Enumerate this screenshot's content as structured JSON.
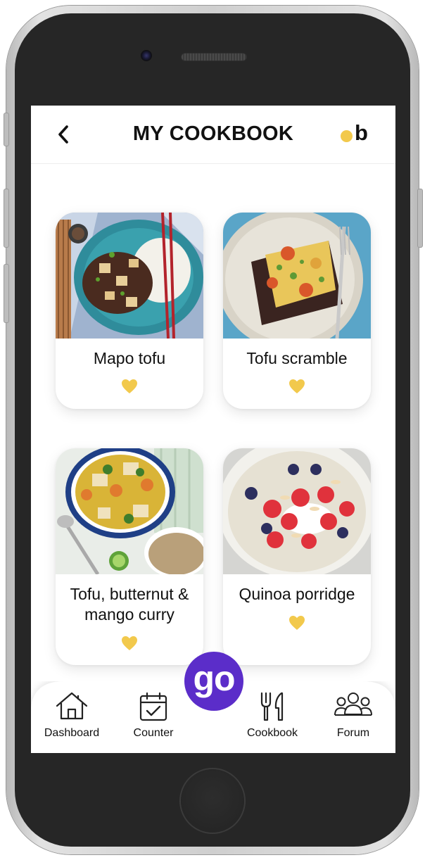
{
  "header": {
    "title": "MY COOKBOOK",
    "back_icon": "chevron-left-icon",
    "brand_letter": "b",
    "brand_dot_color": "#f2c94c"
  },
  "recipes": [
    {
      "title": "Mapo tofu",
      "favorite": true,
      "image": "mapo-tofu-photo"
    },
    {
      "title": "Tofu scramble",
      "favorite": true,
      "image": "tofu-scramble-photo"
    },
    {
      "title": "Tofu, butternut & mango curry",
      "favorite": true,
      "image": "curry-photo"
    },
    {
      "title": "Quinoa porridge",
      "favorite": true,
      "image": "porridge-photo"
    }
  ],
  "tabbar": {
    "items": [
      {
        "label": "Dashboard",
        "icon": "home-icon"
      },
      {
        "label": "Counter",
        "icon": "calendar-check-icon"
      },
      {
        "label": "Cookbook",
        "icon": "fork-knife-icon"
      },
      {
        "label": "Forum",
        "icon": "group-icon"
      }
    ],
    "center_label": "go",
    "center_color": "#5b2dc9"
  },
  "colors": {
    "accent": "#f2c94c",
    "primary": "#5b2dc9",
    "text": "#111111"
  }
}
